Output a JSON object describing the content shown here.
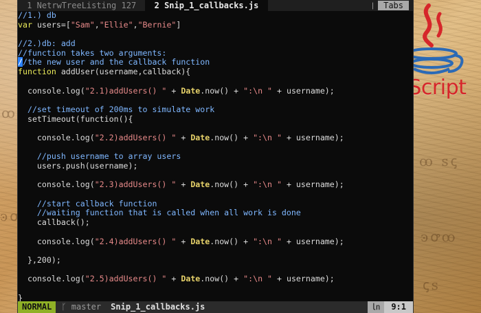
{
  "tabline": {
    "tabs": [
      {
        "label": " 1 NetrwTreeListing 127 ",
        "active": false
      },
      {
        "label": " 2 Snip_1_callbacks.js ",
        "active": true
      }
    ],
    "tabs_pill": "Tabs"
  },
  "statusbar": {
    "mode": "NORMAL",
    "branch": "ᚴ master",
    "file": "Snip_1_callbacks.js",
    "pos_icon": "㏑",
    "position": "9:1"
  },
  "logo": {
    "word": "JavaScript"
  },
  "code_lines": [
    "//1.) db",
    "var users=[\"Sam\",\"Ellie\",\"Bernie\"]",
    "",
    "//2.)db: add",
    "//function takes two arguments:",
    "//the new user and the callback function",
    "function addUser(username,callback){",
    "",
    "  console.log(\"2.1)addUsers() \" + Date.now() + \":\\n \" + username);",
    "",
    "  //set timeout of 200ms to simulate work",
    "  setTimeout(function(){",
    "",
    "    console.log(\"2.2)addUsers() \" + Date.now() + \":\\n \" + username);",
    "",
    "    //push username to array users",
    "    users.push(username);",
    "",
    "    console.log(\"2.3)addUsers() \" + Date.now() + \":\\n \" + username);",
    "",
    "    //start callback function",
    "    //waiting function that is called when all work is done",
    "    callback();",
    "",
    "    console.log(\"2.4)addUsers() \" + Date.now() + \":\\n \" + username);",
    "",
    "  },200);",
    "",
    "  console.log(\"2.5)addUsers() \" + Date.now() + \":\\n \" + username);",
    "",
    "}"
  ]
}
